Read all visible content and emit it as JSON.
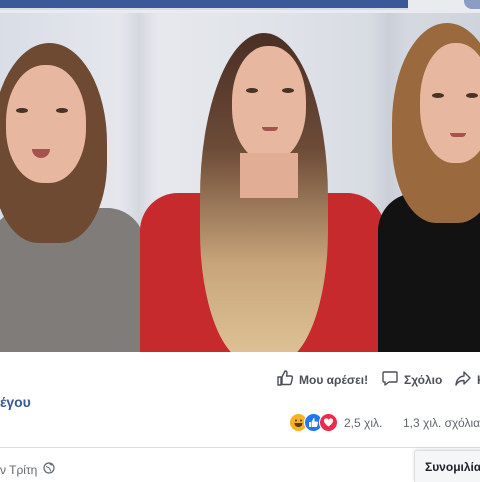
{
  "video": {
    "label": "video-player"
  },
  "actions": {
    "like_label": "Μου αρέσει!",
    "comment_label": "Σχόλιο",
    "share_label": "Κ"
  },
  "post": {
    "page_name_fragment": "έγου",
    "timestamp_fragment": "ν Τρίτη"
  },
  "reactions": {
    "icons": [
      "haha-icon",
      "like-icon",
      "love-icon"
    ],
    "count": "2,5 χιλ.",
    "comments_count": "1,3 χιλ. σχόλια"
  },
  "chat": {
    "tab_label": "Συνομιλία"
  },
  "colors": {
    "facebook_blue": "#3b5998",
    "link_blue": "#385898",
    "like_blue": "#2078f4",
    "love_red": "#f0284a",
    "haha_yellow": "#f7b125",
    "grey_text": "#606770"
  }
}
